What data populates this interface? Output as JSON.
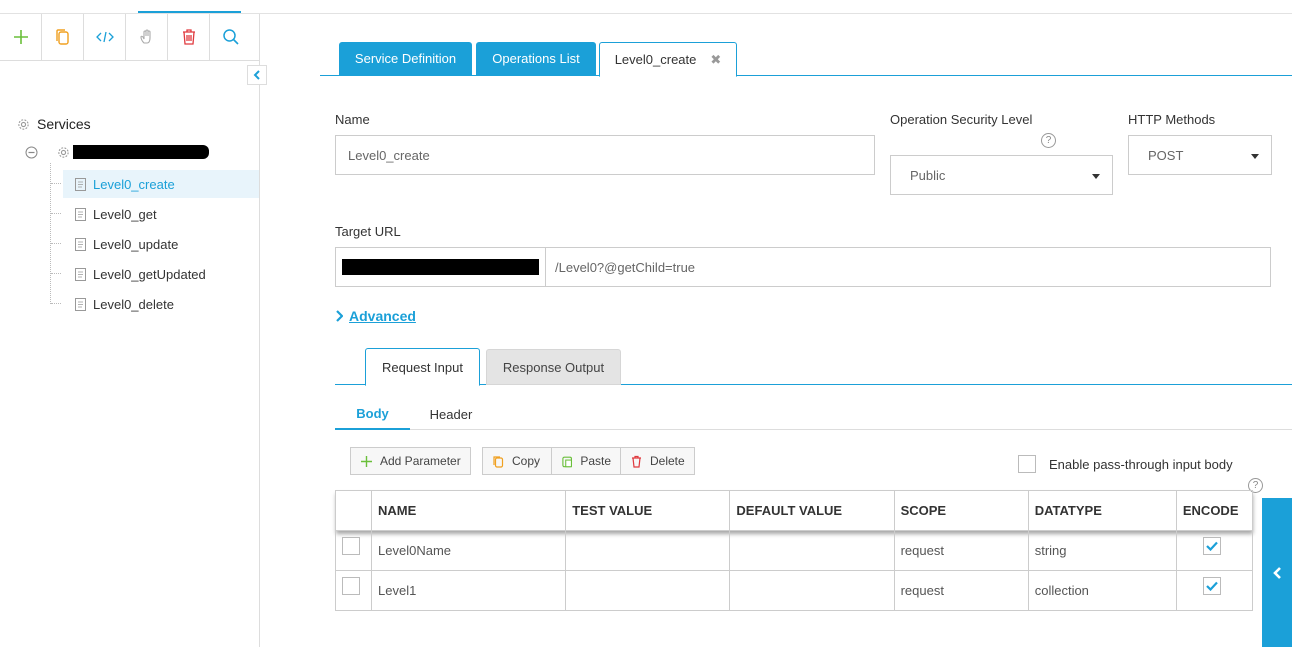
{
  "colors": {
    "accent": "#1ba0d8",
    "selected_bg": "#e8f4fb"
  },
  "sidebar": {
    "root_label": "Services",
    "items": [
      {
        "label": "Level0_create",
        "selected": true
      },
      {
        "label": "Level0_get"
      },
      {
        "label": "Level0_update"
      },
      {
        "label": "Level0_getUpdated"
      },
      {
        "label": "Level0_delete"
      }
    ]
  },
  "tabs": [
    {
      "label": "Service Definition"
    },
    {
      "label": "Operations List"
    },
    {
      "label": "Level0_create",
      "close": "✖"
    }
  ],
  "form": {
    "name_label": "Name",
    "name_value": "Level0_create",
    "security_label": "Operation Security Level",
    "security_value": "Public",
    "http_label": "HTTP Methods",
    "http_value": "POST",
    "target_label": "Target URL",
    "target_path": "/Level0?@getChild=true",
    "help": "?"
  },
  "advanced_label": "Advanced",
  "subtabs": {
    "request": "Request Input",
    "response": "Response Output"
  },
  "bodytabs": {
    "body": "Body",
    "header": "Header"
  },
  "actions": {
    "add": "Add Parameter",
    "copy": "Copy",
    "paste": "Paste",
    "delete": "Delete"
  },
  "passthrough_label": "Enable pass-through input body",
  "table": {
    "columns": [
      "NAME",
      "TEST VALUE",
      "DEFAULT VALUE",
      "SCOPE",
      "DATATYPE",
      "ENCODE"
    ],
    "rows": [
      {
        "name": "Level0Name",
        "test": "",
        "default": "",
        "scope": "request",
        "datatype": "string",
        "encode": true
      },
      {
        "name": "Level1",
        "test": "",
        "default": "",
        "scope": "request",
        "datatype": "collection",
        "encode": true
      }
    ]
  }
}
